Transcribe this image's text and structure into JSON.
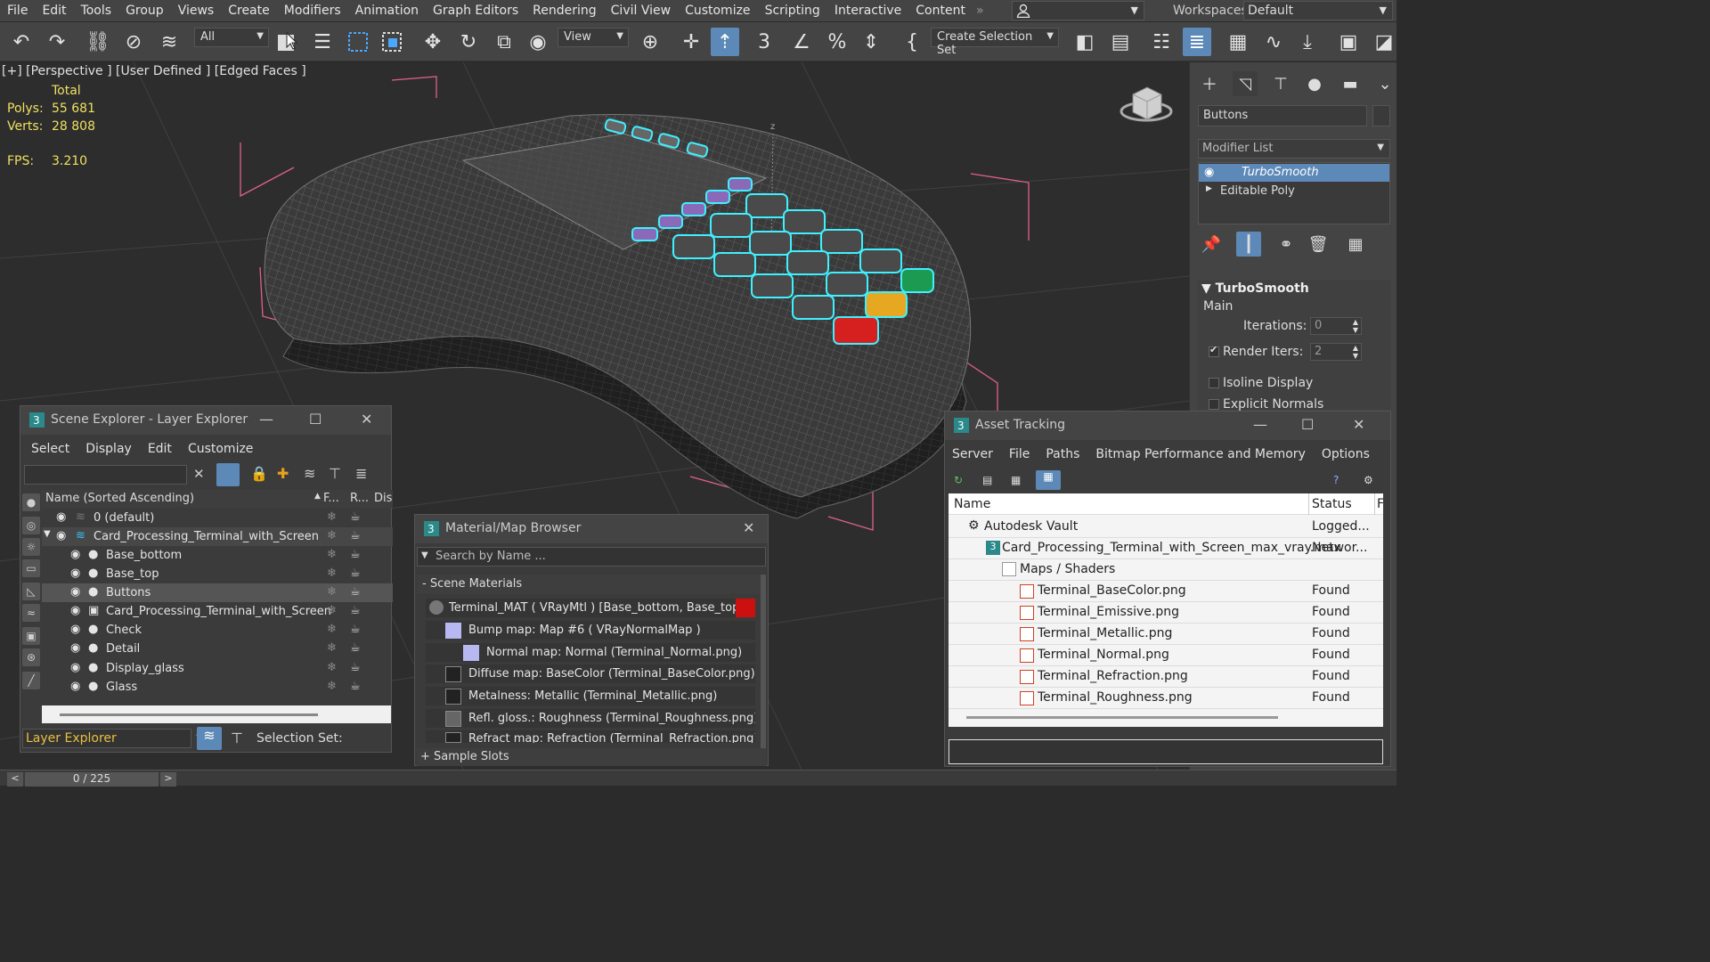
{
  "menubar": {
    "items": [
      "File",
      "Edit",
      "Tools",
      "Group",
      "Views",
      "Create",
      "Modifiers",
      "Animation",
      "Graph Editors",
      "Rendering",
      "Civil View",
      "Customize",
      "Scripting",
      "Interactive",
      "Content"
    ],
    "more": "»",
    "workspaces_label": "Workspaces:",
    "workspace_value": "Default"
  },
  "toolbar": {
    "filter_value": "All",
    "view_value": "View",
    "selection_set": "Create Selection Set"
  },
  "viewport": {
    "label": "[+] [Perspective ] [User Defined ] [Edged Faces ]",
    "stats": {
      "total_label": "Total",
      "polys_label": "Polys:",
      "polys_value": "55 681",
      "verts_label": "Verts:",
      "verts_value": "28 808",
      "fps_label": "FPS:",
      "fps_value": "3.210"
    },
    "axis_label": "z"
  },
  "command_panel": {
    "object_name": "Buttons",
    "modifier_list": "Modifier List",
    "stack": [
      "TurboSmooth",
      "Editable Poly"
    ],
    "rollout": {
      "title": "TurboSmooth",
      "group": "Main",
      "iterations_label": "Iterations:",
      "iterations_value": "0",
      "render_iters_label": "Render Iters:",
      "render_iters_value": "2",
      "isoline_label": "Isoline Display",
      "explicit_label": "Explicit Normals"
    }
  },
  "scene_explorer": {
    "title": "Scene Explorer - Layer Explorer",
    "menu": [
      "Select",
      "Display",
      "Edit",
      "Customize"
    ],
    "columns": {
      "name": "Name (Sorted Ascending)",
      "f": "F...",
      "r": "R...",
      "dis": "Dis"
    },
    "rows": [
      {
        "name": "0 (default)"
      },
      {
        "name": "Card_Processing_Terminal_with_Screen"
      },
      {
        "name": "Base_bottom"
      },
      {
        "name": "Base_top"
      },
      {
        "name": "Buttons"
      },
      {
        "name": "Card_Processing_Terminal_with_Screen"
      },
      {
        "name": "Check"
      },
      {
        "name": "Detail"
      },
      {
        "name": "Display_glass"
      },
      {
        "name": "Glass"
      }
    ],
    "footer_label": "Layer Explorer",
    "selection_set_label": "Selection Set:"
  },
  "material_browser": {
    "title": "Material/Map Browser",
    "search_placeholder": "Search by Name ...",
    "section": "- Scene Materials",
    "rows": [
      "Terminal_MAT  ( VRayMtl )  [Base_bottom, Base_top,...",
      "Bump map: Map #6  ( VRayNormalMap )",
      "Normal map: Normal (Terminal_Normal.png)",
      "Diffuse map: BaseColor (Terminal_BaseColor.png)",
      "Metalness: Metallic (Terminal_Metallic.png)",
      "Refl. gloss.: Roughness (Terminal_Roughness.png)",
      "Refract map: Refraction (Terminal_Refraction.png)"
    ],
    "sample_slots": "+ Sample Slots"
  },
  "asset_tracking": {
    "title": "Asset Tracking",
    "menu": [
      "Server",
      "File",
      "Paths",
      "Bitmap Performance and Memory",
      "Options"
    ],
    "columns": {
      "name": "Name",
      "status": "Status",
      "extra": "F"
    },
    "rows": [
      {
        "name": "Autodesk Vault",
        "status": "Logged..."
      },
      {
        "name": "Card_Processing_Terminal_with_Screen_max_vray.max",
        "status": "Networ..."
      },
      {
        "name": "Maps / Shaders",
        "status": ""
      },
      {
        "name": "Terminal_BaseColor.png",
        "status": "Found"
      },
      {
        "name": "Terminal_Emissive.png",
        "status": "Found"
      },
      {
        "name": "Terminal_Metallic.png",
        "status": "Found"
      },
      {
        "name": "Terminal_Normal.png",
        "status": "Found"
      },
      {
        "name": "Terminal_Refraction.png",
        "status": "Found"
      },
      {
        "name": "Terminal_Roughness.png",
        "status": "Found"
      }
    ]
  },
  "timeline": {
    "frame": "0 / 225",
    "prev": "<",
    "next": ">"
  },
  "colors": {
    "accent": "#5d89b8",
    "stats": "#f0e060",
    "selection_outline": "#3ff0ff",
    "bbox": "#e0608a"
  }
}
